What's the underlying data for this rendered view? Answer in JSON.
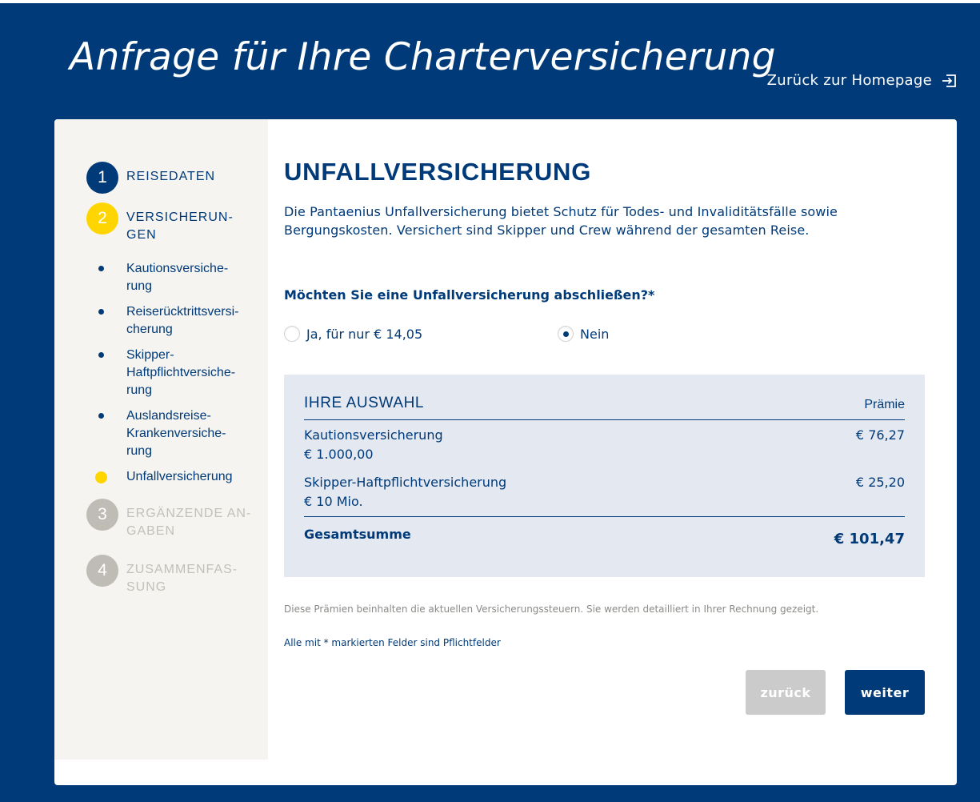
{
  "header": {
    "title": "Anfrage für Ihre Charterversicherung",
    "home_link": "Zurück zur Homepage",
    "home_icon": "exit-icon"
  },
  "sidebar": {
    "steps": [
      {
        "number": "1",
        "label": "REISEDATEN",
        "state": "done"
      },
      {
        "number": "2",
        "label": "VERSICHERUN-\nGEN",
        "state": "active"
      },
      {
        "number": "3",
        "label": "ERGÄNZENDE AN-\nGABEN",
        "state": "pending"
      },
      {
        "number": "4",
        "label": "ZUSAMMENFAS-\nSUNG",
        "state": "pending"
      }
    ],
    "substeps": [
      {
        "label": "Kautionsversiche-\nrung"
      },
      {
        "label": "Reiserücktrittsversi-\ncherung"
      },
      {
        "label": "Skipper-\nHaftpflichtversiche-\nrung"
      },
      {
        "label": "Auslandsreise-\nKrankenversiche-\nrung"
      },
      {
        "label": "Unfallversicherung",
        "current": true
      }
    ]
  },
  "main": {
    "title": "UNFALLVERSICHERUNG",
    "intro": "Die Pantaenius Unfallversicherung bietet Schutz für Todes- und Invaliditätsfälle sowie Bergungskosten. Versichert sind Skipper und Crew während der gesamten Reise.",
    "question": "Möchten Sie eine Unfallversicherung abschließen?*",
    "options": [
      {
        "label": "Ja, für nur € 14,05",
        "selected": false
      },
      {
        "label": "Nein",
        "selected": true
      }
    ]
  },
  "summary": {
    "title": "IHRE AUSWAHL",
    "premium_label": "Prämie",
    "rows": [
      {
        "name": "Kautionsversicherung",
        "detail": "€ 1.000,00",
        "price": "€ 76,27"
      },
      {
        "name": "Skipper-Haftpflichtversicherung",
        "detail": "€ 10 Mio.",
        "price": "€ 25,20"
      }
    ],
    "total_label": "Gesamtsumme",
    "total_value": "€ 101,47"
  },
  "notes": {
    "tax": "Diese Prämien beinhalten die aktuellen Versicherungssteuern. Sie werden detailliert in Ihrer Rechnung gezeigt.",
    "required": "Alle mit * markierten Felder sind Pflichtfelder"
  },
  "buttons": {
    "back": "zurück",
    "next": "weiter"
  },
  "colors": {
    "brand_blue": "#003a78",
    "accent_yellow": "#ffd500",
    "sidebar_bg": "#f5f4f0",
    "summary_bg": "#e4e8f0",
    "disabled_gray": "#cbcbcb"
  }
}
